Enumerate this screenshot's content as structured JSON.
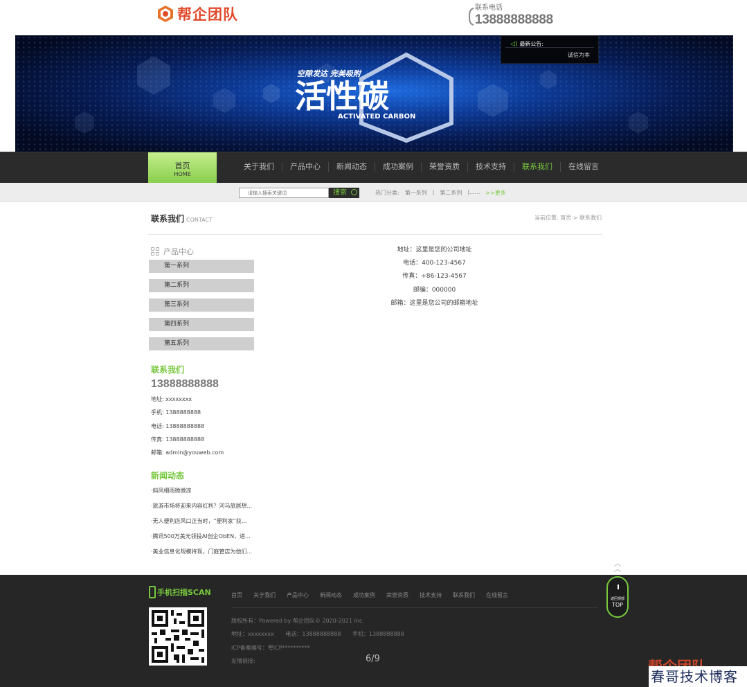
{
  "header": {
    "logo_text": "帮企团队",
    "phone_label": "联系电话",
    "phone_number": "13888888888"
  },
  "banner": {
    "notice_title": "最新公告:",
    "notice_text": "诚信为本",
    "slogan_sub": "空隙发达 完美吸附",
    "slogan_main": "活性碳",
    "slogan_en": "ACTIVATED CARBON"
  },
  "nav": {
    "home_label": "首页",
    "home_sub": "HOME",
    "items": [
      {
        "label": "关于我们",
        "active": false
      },
      {
        "label": "产品中心",
        "active": false
      },
      {
        "label": "新闻动态",
        "active": false
      },
      {
        "label": "成功案例",
        "active": false
      },
      {
        "label": "荣誉资质",
        "active": false
      },
      {
        "label": "技术支持",
        "active": false
      },
      {
        "label": "联系我们",
        "active": true
      },
      {
        "label": "在线留言",
        "active": false
      }
    ]
  },
  "search": {
    "placeholder": "请输入搜索关键词",
    "button": "搜索",
    "hot_label": "热门分类:",
    "hot_items": [
      "第一系列",
      "|",
      "第二系列",
      "|......"
    ],
    "more": ">>更多"
  },
  "page": {
    "title": "联系我们",
    "title_en": "CONTACT",
    "breadcrumb": "当前位置: 首页 > 联系我们"
  },
  "sidebar": {
    "heading": "产品中心",
    "categories": [
      "第一系列",
      "第二系列",
      "第三系列",
      "第四系列",
      "第五系列"
    ],
    "contact_heading": "联系我们",
    "contact_phone": "13888888888",
    "contact_lines": [
      "地址: xxxxxxxx",
      "手机: 1388888888",
      "电话: 13888888888",
      "传真: 13888888888",
      "邮箱: admin@youweb.com"
    ],
    "news_heading": "新闻动态",
    "news": [
      "·斜风细雨微微凉",
      "·旅游市场将迎来内容红利？河马旅居想...",
      "·无人便利店风口正当时，“便利家”获...",
      "·腾讯500万美元领投AI创企ObEN，进...",
      "·美业信息化规模将现，门庭管店为他们..."
    ]
  },
  "main": {
    "lines": [
      "地址：这里是您的公司地址",
      "电话：400-123-4567",
      "传真：+86-123-4567",
      "邮编：000000",
      "邮箱：这里是您公司的邮箱地址"
    ]
  },
  "footer": {
    "scan_label": "手机扫描SCAN",
    "nav": [
      "首页",
      "关于我们",
      "产品中心",
      "新闻动态",
      "成功案例",
      "荣誉资质",
      "技术支持",
      "联系我们",
      "在线留言"
    ],
    "copyright": "版权所有：Powered by 帮企团队© 2020-2021 Inc.",
    "address": "地址：xxxxxxxx",
    "tel": "电话：13888888888",
    "mobile": "手机：1388888888",
    "icp": "ICP备案编号：粤ICP**********",
    "links": "友情链接:",
    "pager": "6/9"
  },
  "back_to_top": {
    "small": "返回顶部",
    "big": "TOP"
  },
  "watermark": {
    "logo": "帮企团队",
    "text": "春哥技术博客"
  },
  "colors": {
    "accent": "#77c83e",
    "nav_bg": "#2b2b2b",
    "footer_bg": "#262626",
    "logo": "#e04a2a"
  }
}
